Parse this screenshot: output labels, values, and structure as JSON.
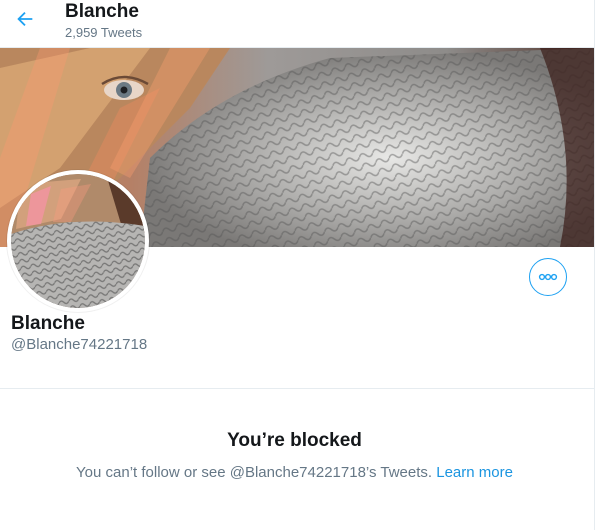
{
  "header": {
    "title": "Blanche",
    "tweet_count": "2,959 Tweets"
  },
  "profile": {
    "name": "Blanche",
    "handle": "@Blanche74221718"
  },
  "blocked": {
    "title": "You’re blocked",
    "message": "You can’t follow or see @Blanche74221718’s Tweets.",
    "link": "Learn more"
  },
  "icons": {
    "back": "arrow-left-icon",
    "more": "more-dots-icon"
  },
  "colors": {
    "accent": "#1da1f2",
    "link": "#1b95e0",
    "text_primary": "#14171a",
    "text_secondary": "#657786",
    "divider": "#e6ecf0"
  }
}
